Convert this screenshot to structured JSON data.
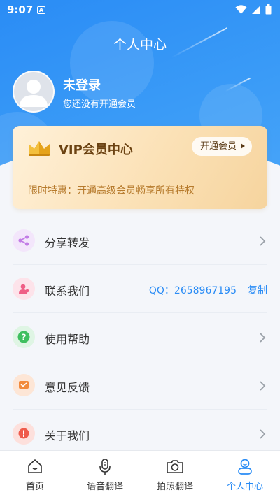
{
  "status_bar": {
    "time": "9:07",
    "notif_letter": "A"
  },
  "header": {
    "title": "个人中心"
  },
  "user": {
    "name": "未登录",
    "subtitle": "您还没有开通会员"
  },
  "vip": {
    "title": "VIP会员中心",
    "button_label": "开通会员",
    "promo": "限时特惠：开通高级会员畅享所有特权"
  },
  "menu": {
    "share": {
      "label": "分享转发"
    },
    "contact": {
      "label": "联系我们",
      "qq": "QQ：2658967195",
      "copy": "复制"
    },
    "help": {
      "label": "使用帮助"
    },
    "feedback": {
      "label": "意见反馈"
    },
    "about": {
      "label": "关于我们"
    }
  },
  "tabs": [
    {
      "label": "首页",
      "icon": "home-icon"
    },
    {
      "label": "语音翻译",
      "icon": "microphone-icon"
    },
    {
      "label": "拍照翻译",
      "icon": "camera-icon"
    },
    {
      "label": "个人中心",
      "icon": "user-icon"
    }
  ],
  "colors": {
    "accent": "#2a8cf5",
    "vip_text": "#6b4212",
    "promo_text": "#b67a2c"
  }
}
